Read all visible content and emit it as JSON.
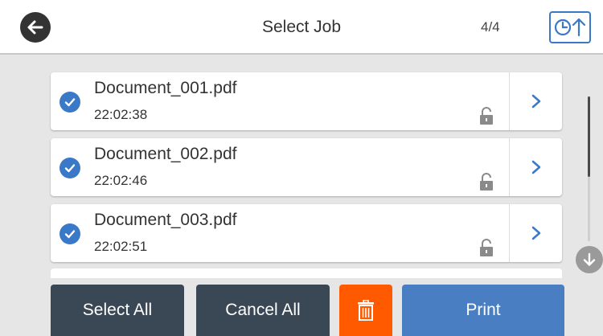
{
  "header": {
    "title": "Select Job",
    "page_counter": "4/4"
  },
  "jobs": [
    {
      "name": "Document_001.pdf",
      "time": "22:02:38",
      "checked": true,
      "locked": true
    },
    {
      "name": "Document_002.pdf",
      "time": "22:02:46",
      "checked": true,
      "locked": true
    },
    {
      "name": "Document_003.pdf",
      "time": "22:02:51",
      "checked": true,
      "locked": true
    }
  ],
  "toolbar": {
    "select_all_label": "Select All",
    "cancel_all_label": "Cancel All",
    "print_label": "Print"
  },
  "colors": {
    "accent": "#3a78c8",
    "toolbar_button": "#3a4755",
    "delete": "#ff5a00",
    "print": "#4a7ec2"
  },
  "icons": {
    "back": "back-arrow-icon",
    "sort": "clock-up-arrow-icon",
    "check": "checkmark-icon",
    "lock": "unlock-icon",
    "chevron": "chevron-right-icon",
    "scroll_down": "arrow-down-icon",
    "delete": "trash-icon"
  }
}
